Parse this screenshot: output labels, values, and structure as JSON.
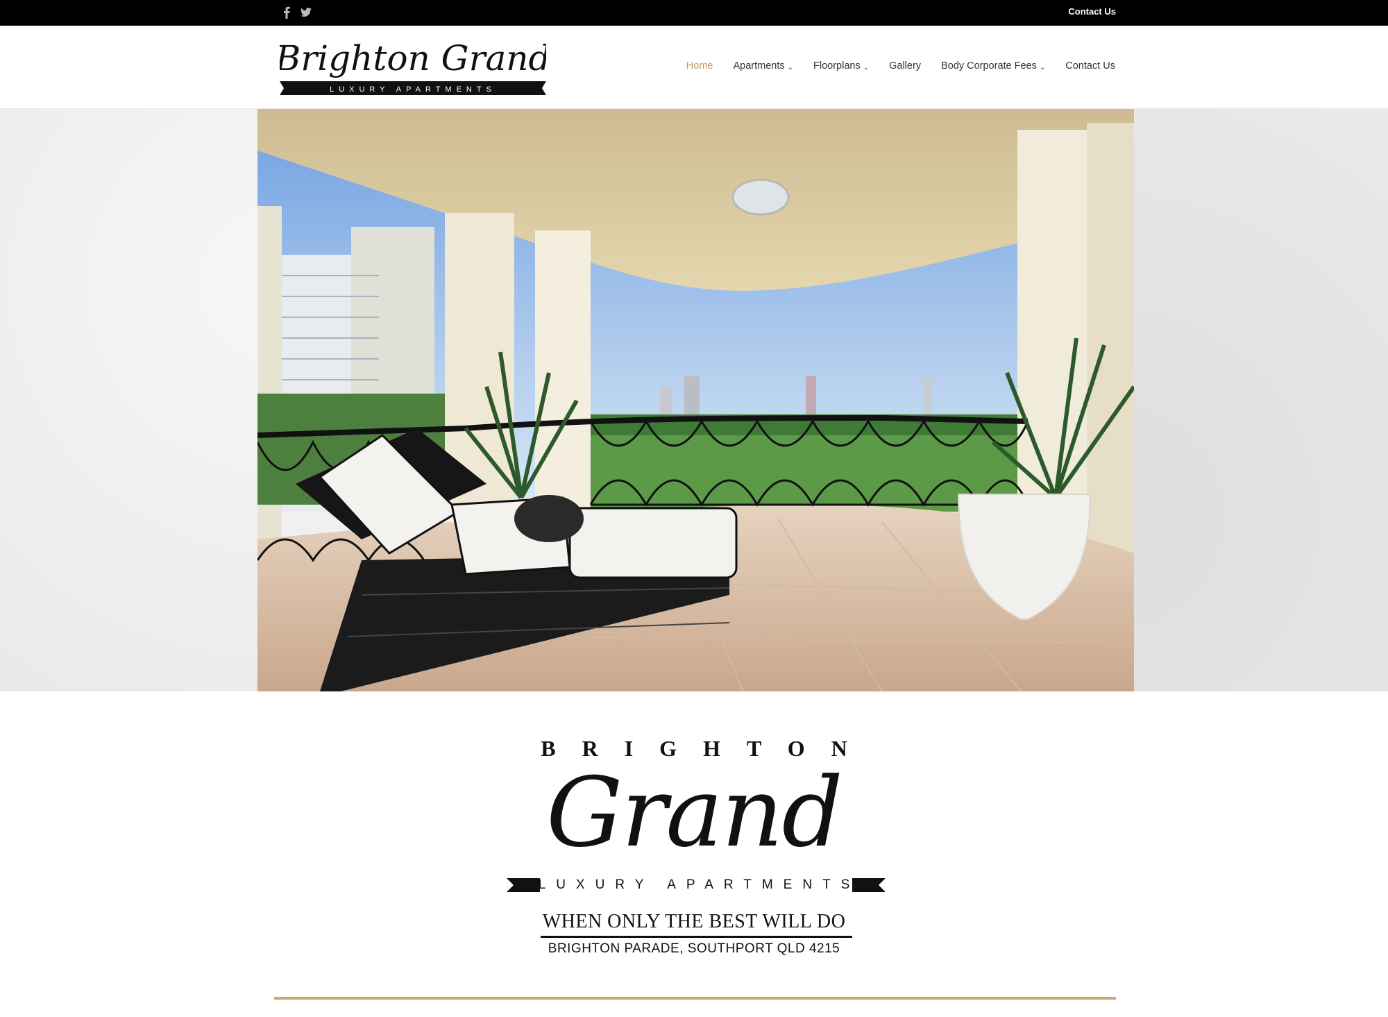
{
  "topbar": {
    "social_icons": [
      "facebook-icon",
      "twitter-icon"
    ],
    "contact_label": "Contact Us"
  },
  "header": {
    "logo": {
      "name": "Brighton Grand",
      "subtitle": "LUXURY APARTMENTS"
    },
    "nav": [
      {
        "label": "Home",
        "active": true,
        "dropdown": false
      },
      {
        "label": "Apartments",
        "active": false,
        "dropdown": true
      },
      {
        "label": "Floorplans",
        "active": false,
        "dropdown": true
      },
      {
        "label": "Gallery",
        "active": false,
        "dropdown": false
      },
      {
        "label": "Body Corporate Fees",
        "active": false,
        "dropdown": true
      },
      {
        "label": "Contact Us",
        "active": false,
        "dropdown": false
      }
    ]
  },
  "brand": {
    "top": "BRIGHTON",
    "script": "Grand",
    "ribbon": "LUXURY APARTMENTS",
    "tagline": "WHEN ONLY THE BEST WILL DO",
    "address": "BRIGHTON PARADE, SOUTHPORT QLD 4215"
  },
  "colors": {
    "accent": "#c49a5f",
    "divider": "#d4a469",
    "topbar": "#000000"
  }
}
